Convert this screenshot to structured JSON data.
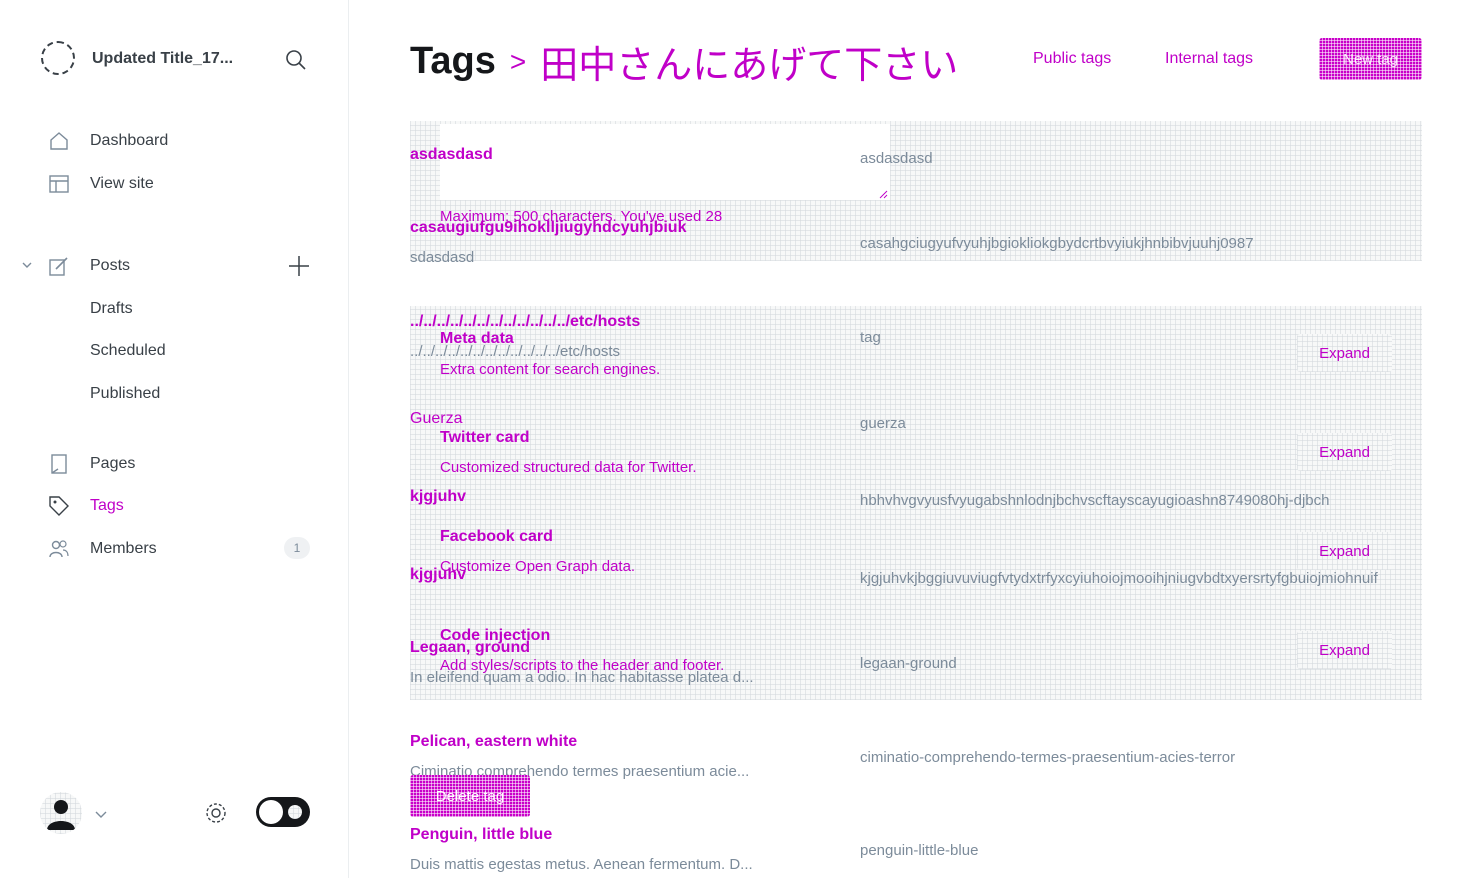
{
  "site": {
    "title": "Updated Title_17..."
  },
  "sidebar": {
    "dashboard": "Dashboard",
    "view_site": "View site",
    "posts": "Posts",
    "drafts": "Drafts",
    "scheduled": "Scheduled",
    "published": "Published",
    "pages": "Pages",
    "tags": "Tags",
    "members": "Members",
    "members_count": "1"
  },
  "header": {
    "breadcrumb": "Tags",
    "separator": ">",
    "current": "田中さんにあげて下さい",
    "public_tags": "Public tags",
    "internal_tags": "Internal tags",
    "new_tag": "New tag"
  },
  "tags": [
    {
      "name": "asdasdasd",
      "slug": "asdasdasd"
    },
    {
      "name": "casaugiufgu9ihoklljiugyhdcyuhjbiuk",
      "desc": "sdasdasd",
      "slug": "casahgciugyufvyuhjbgiokliokgbydcrtbvyiukjhnbibvjuuhj0987"
    },
    {
      "name": "../../../../../../../../../../../../etc/hosts",
      "desc": "../../../../../../../../../../../../etc/hosts",
      "slug": "tag"
    },
    {
      "name": "Guerza",
      "slug": "guerza"
    },
    {
      "name": "kjgjuhv",
      "slug": "hbhvhvgvyusfvyugabshnlodnjbchvscftayscayugioashn8749080hj-djbch"
    },
    {
      "name": "kjgjuhv",
      "slug": "kjgjuhvkjbggiuvuviugfvtydxtrfyxcyiuhoiojmooihjniugvbdtxyersrtyfgbuiojmiohnuif"
    },
    {
      "name": "Legaan, ground",
      "desc": "In eleifend quam a odio. In hac habitasse platea d...",
      "slug": "legaan-ground"
    },
    {
      "name": "Pelican, eastern white",
      "desc": "Ciminatio comprehendo termes praesentium acie...",
      "slug": "ciminatio-comprehendo-termes-praesentium-acies-terror"
    },
    {
      "name": "Penguin, little blue",
      "desc": "Duis mattis egestas metus. Aenean fermentum. D...",
      "slug": "penguin-little-blue"
    }
  ],
  "overlay": {
    "char_counter": "Maximum: 500 characters. You've used 28",
    "meta_title": "Meta data",
    "meta_sub": "Extra content for search engines.",
    "twitter_title": "Twitter card",
    "twitter_sub": "Customized structured data for Twitter.",
    "facebook_title": "Facebook card",
    "facebook_sub": "Customize Open Graph data.",
    "code_title": "Code injection",
    "code_sub": "Add styles/scripts to the header and footer.",
    "expand": "Expand",
    "delete_tag": "Delete tag"
  },
  "colors": {
    "accent": "#c900c9",
    "panel": "#f7f8f8"
  }
}
